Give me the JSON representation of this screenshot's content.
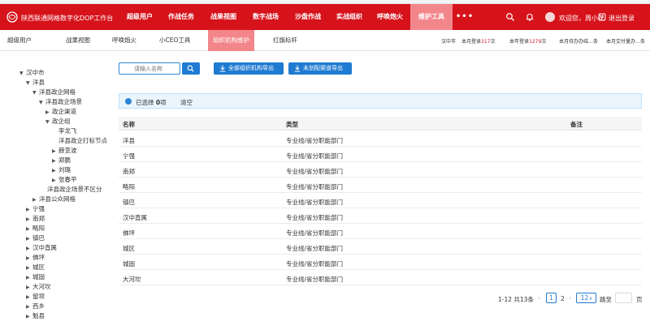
{
  "header": {
    "app_title": "陕西联通网格数字化DOP工作台",
    "nav": [
      "超级用户",
      "作战任务",
      "战果视图",
      "数字战场",
      "沙盘作战",
      "实战组织",
      "呼唤炮火",
      "维护工具",
      "•••"
    ],
    "active_nav": "维护工具",
    "welcome": "欢迎您，周小花",
    "logout": "退出登录",
    "brand_color": "#d6121b"
  },
  "subnav": {
    "tabs": [
      "超级用户",
      "战果视图",
      "呼唤炮火",
      "小CEO工具",
      "组织机构维护",
      "红旗标杆"
    ],
    "active_tab": "组织机构维护",
    "stats": {
      "city": "汉中市",
      "month_label": "本月登录",
      "month_count": "317",
      "year_label": "本年登录",
      "year_count": "1279",
      "unit": "次",
      "pending": "本月待办办结…条",
      "delivered": "本月交付量办…条"
    }
  },
  "tree": [
    {
      "label": "汉中市",
      "caret": "▼"
    },
    {
      "label": "洋县",
      "caret": "▼"
    },
    {
      "label": "洋县政企网格",
      "caret": "▼"
    },
    {
      "label": "洋县政企场景",
      "caret": "▼"
    },
    {
      "label": "政企渠道",
      "caret": "▶"
    },
    {
      "label": "政企组",
      "caret": "▼"
    },
    {
      "label": "李龙飞",
      "caret": ""
    },
    {
      "label": "洋县政企打标节点",
      "caret": ""
    },
    {
      "label": "薛亚波",
      "caret": "▶"
    },
    {
      "label": "郑鹏",
      "caret": "▶"
    },
    {
      "label": "刘璐",
      "caret": "▶"
    },
    {
      "label": "张春平",
      "caret": "▶"
    },
    {
      "label": "洋县政企场景不区分",
      "caret": ""
    },
    {
      "label": "洋县公众网格",
      "caret": "▶"
    },
    {
      "label": "宁强",
      "caret": "▶"
    },
    {
      "label": "南郑",
      "caret": "▶"
    },
    {
      "label": "略阳",
      "caret": "▶"
    },
    {
      "label": "镇巴",
      "caret": "▶"
    },
    {
      "label": "汉中直属",
      "caret": "▶"
    },
    {
      "label": "佛坪",
      "caret": "▶"
    },
    {
      "label": "城区",
      "caret": "▶"
    },
    {
      "label": "城固",
      "caret": "▶"
    },
    {
      "label": "大河坎",
      "caret": "▶"
    },
    {
      "label": "留坝",
      "caret": "▶"
    },
    {
      "label": "西乡",
      "caret": "▶"
    },
    {
      "label": "勉县",
      "caret": "▶"
    }
  ],
  "toolbar": {
    "search_placeholder": "请输入名称",
    "export_all": "全部组织机构导出",
    "export_unconfigured": "未划配渠道导出"
  },
  "selection": {
    "prefix": "已选择",
    "count": "0",
    "suffix": "项",
    "clear": "清空"
  },
  "table": {
    "columns": [
      "名称",
      "类型",
      "备注"
    ],
    "rows": [
      {
        "name": "洋县",
        "type": "专业线/省分职能部门",
        "note": ""
      },
      {
        "name": "宁强",
        "type": "专业线/省分职能部门",
        "note": ""
      },
      {
        "name": "南郑",
        "type": "专业线/省分职能部门",
        "note": ""
      },
      {
        "name": "略阳",
        "type": "专业线/省分职能部门",
        "note": ""
      },
      {
        "name": "镇巴",
        "type": "专业线/省分职能部门",
        "note": ""
      },
      {
        "name": "汉中直属",
        "type": "专业线/省分职能部门",
        "note": ""
      },
      {
        "name": "佛坪",
        "type": "专业线/省分职能部门",
        "note": ""
      },
      {
        "name": "城区",
        "type": "专业线/省分职能部门",
        "note": ""
      },
      {
        "name": "城固",
        "type": "专业线/省分职能部门",
        "note": ""
      },
      {
        "name": "大河坎",
        "type": "专业线/省分职能部门",
        "note": ""
      }
    ]
  },
  "pagination": {
    "summary": "1-12 共13条",
    "pages": [
      "1",
      "2"
    ],
    "current": "1",
    "page_size": "12",
    "goto_label": "跳至",
    "page_unit": "页"
  }
}
